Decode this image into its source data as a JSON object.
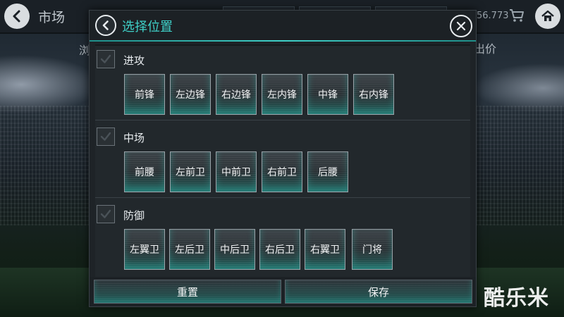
{
  "topbar": {
    "title": "市场",
    "coins": "56.773",
    "sub_left": "浏",
    "sub_right": "出价"
  },
  "modal": {
    "title": "选择位置",
    "groups": [
      {
        "label": "进攻",
        "checked": true,
        "positions": [
          "前锋",
          "左边锋",
          "右边锋",
          "左内锋",
          "中锋",
          "右内锋"
        ]
      },
      {
        "label": "中场",
        "checked": true,
        "positions": [
          "前腰",
          "左前卫",
          "中前卫",
          "右前卫",
          "后腰"
        ]
      },
      {
        "label": "防御",
        "checked": true,
        "positions": [
          "左翼卫",
          "左后卫",
          "中后卫",
          "右后卫",
          "右翼卫",
          "门将"
        ]
      }
    ],
    "reset_label": "重置",
    "save_label": "保存"
  },
  "watermark": "酷乐米",
  "colors": {
    "accent": "#3fd0c8",
    "panel": "#22282c",
    "header": "#1c2125"
  }
}
